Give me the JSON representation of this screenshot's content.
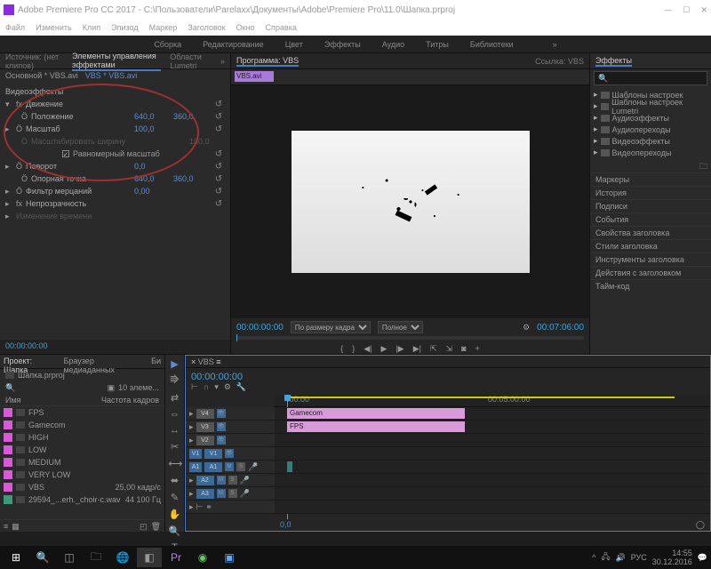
{
  "title": "Adobe Premiere Pro CC 2017 - C:\\Пользователи\\Parelaxx\\Документы\\Adobe\\Premiere Pro\\11.0\\Шапка.prproj",
  "menu": [
    "Файл",
    "Изменить",
    "Клип",
    "Эпизод",
    "Маркер",
    "Заголовок",
    "Окно",
    "Справка"
  ],
  "ws": [
    "Сборка",
    "Редактирование",
    "Цвет",
    "Эффекты",
    "Аудио",
    "Титры",
    "Библиотеки"
  ],
  "srcTabs": {
    "none": "Источник: (нет клипов)",
    "active": "Элементы управления эффектами",
    "lumetri": "Области Lumetri"
  },
  "srcRow": {
    "base": "Основной * VBS.avi",
    "link": "VBS * VBS.avi"
  },
  "fx": {
    "videoHdr": "Видеоэффекты",
    "motion": "Движение",
    "position": {
      "lbl": "Положение",
      "x": "640,0",
      "y": "360,0"
    },
    "scale": {
      "lbl": "Масштаб",
      "v": "100,0"
    },
    "scaleW": {
      "lbl": "Масштабировать ширину",
      "v": "100,0"
    },
    "uniform": "Равномерный масштаб",
    "rotation": {
      "lbl": "Поворот",
      "v": "0,0"
    },
    "anchor": {
      "lbl": "Опорная точка",
      "x": "640,0",
      "y": "360,0"
    },
    "flicker": {
      "lbl": "Фильтр мерцаний",
      "v": "0,00"
    },
    "opacity": "Непрозрачность",
    "timeRemap": "Изменение времени"
  },
  "tcLeft": "00:00:00:00",
  "prog": {
    "tab": "Программа: VBS",
    "link": "Ссылка: VBS",
    "clip": "VBS.avi",
    "tc1": "00:00:00:00",
    "fit": "По размеру кадра",
    "full": "Полное",
    "tc2": "00:07:06:00"
  },
  "effects": {
    "title": "Эффекты",
    "items": [
      "Шаблоны настроек",
      "Шаблоны настроек Lumetri",
      "Аудиоэффекты",
      "Аудиопереходы",
      "Видеоэффекты",
      "Видеопереходы"
    ]
  },
  "side": [
    "Маркеры",
    "История",
    "Подписи",
    "События",
    "Свойства заголовка",
    "Стили заголовка",
    "Инструменты заголовка",
    "Действия с заголовком",
    "Тайм-код"
  ],
  "proj": {
    "tab1": "Проект: Шапка",
    "tab2": "Браузер медиаданных",
    "tab3": "Би",
    "name": "Шапка.prproj",
    "count": "10 элеме...",
    "col1": "Имя",
    "col2": "Частота кадров",
    "items": [
      {
        "c": "#d85ad8",
        "n": "FPS",
        "r": ""
      },
      {
        "c": "#d85ad8",
        "n": "Gamecom",
        "r": ""
      },
      {
        "c": "#d85ad8",
        "n": "HIGH",
        "r": ""
      },
      {
        "c": "#d85ad8",
        "n": "LOW",
        "r": ""
      },
      {
        "c": "#d85ad8",
        "n": "MEDIUM",
        "r": ""
      },
      {
        "c": "#d85ad8",
        "n": "VERY LOW",
        "r": ""
      },
      {
        "c": "#d85ad8",
        "n": "VBS",
        "r": "25,00 кадр/с"
      },
      {
        "c": "#3a9a7a",
        "n": "29594_...erh._choir-c.wav",
        "r": "44 100 Гц"
      }
    ]
  },
  "tl": {
    "tab": "VBS",
    "tc": "00:00:00:00",
    "r1": ":00:00",
    "r2": "00:05:00:00",
    "v4": "V4",
    "v3": "V3",
    "v2": "V2",
    "v1": "V1",
    "a1": "A1",
    "a2": "A2",
    "a3": "A3",
    "gamecom": "Gamecom",
    "fps": "FPS",
    "zoom": "0,0"
  },
  "tray": {
    "lang": "РУС",
    "time": "14:55",
    "date": "30.12.2016"
  }
}
